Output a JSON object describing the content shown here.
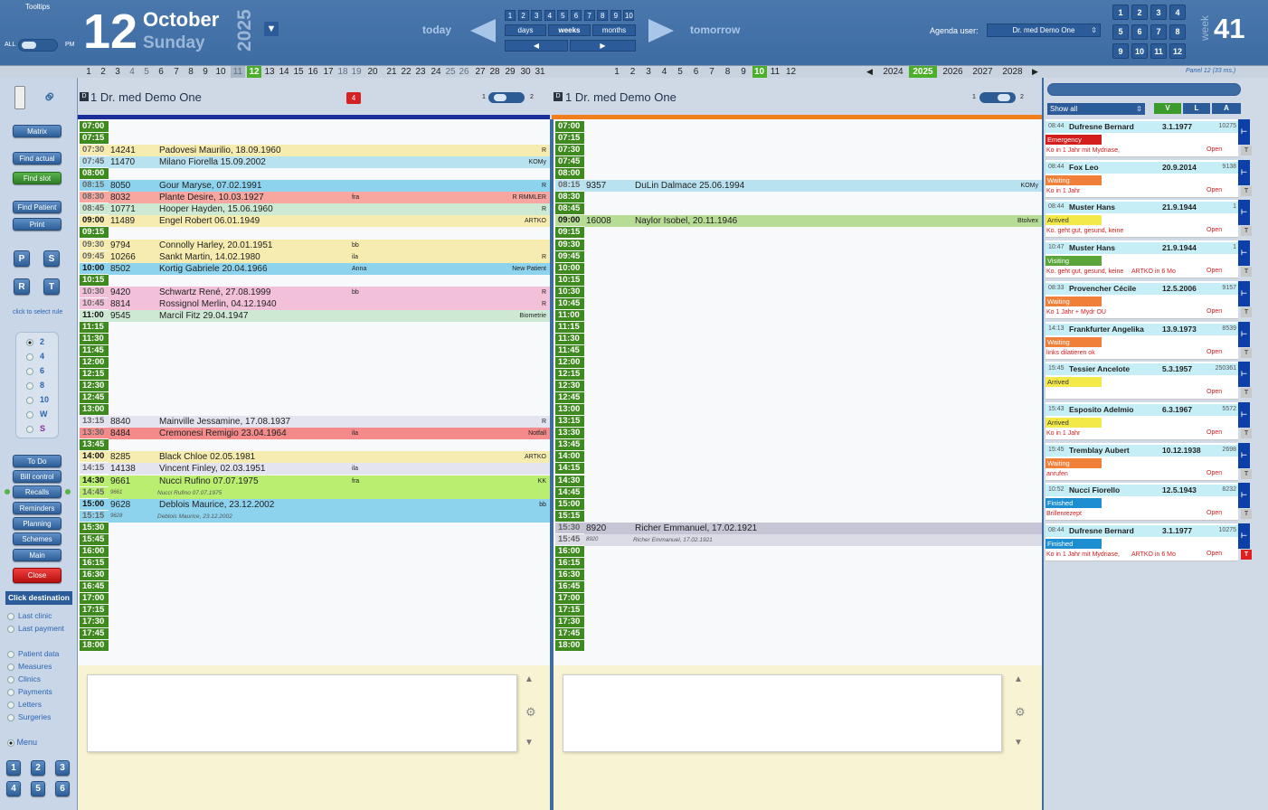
{
  "top": {
    "tooltips": "Tooltips",
    "all": "ALL",
    "pm": "PM",
    "day": "12",
    "month": "October",
    "weekday": "Sunday",
    "year": "2025",
    "today": "today",
    "tomorrow": "tomorrow",
    "nums": [
      "1",
      "2",
      "3",
      "4",
      "5",
      "6",
      "7",
      "8",
      "9",
      "10"
    ],
    "days": "days",
    "weeks": "weeks",
    "months": "months",
    "agenda_label": "Agenda user:",
    "agenda_user": "Dr. med Demo One",
    "week_label": "week",
    "week_num": "41",
    "week_grid": [
      "1",
      "2",
      "3",
      "4",
      "5",
      "6",
      "7",
      "8",
      "9",
      "10",
      "11",
      "12"
    ]
  },
  "daystrip": {
    "days": [
      "1",
      "2",
      "3",
      "4",
      "5",
      "6",
      "7",
      "8",
      "9",
      "10",
      "11",
      "12",
      "13",
      "14",
      "15",
      "16",
      "17",
      "18",
      "19",
      "20",
      "21",
      "22",
      "23",
      "24",
      "25",
      "26",
      "27",
      "28",
      "29",
      "30",
      "31"
    ],
    "months": [
      "1",
      "2",
      "3",
      "4",
      "5",
      "6",
      "7",
      "8",
      "9",
      "10",
      "11",
      "12"
    ],
    "years": [
      "2024",
      "2025",
      "2026",
      "2027",
      "2028"
    ],
    "panel": "Panel 12 (33 ms.)"
  },
  "left": {
    "matrix": "Matrix",
    "find_actual": "Find actual",
    "find_slot": "Find slot",
    "find_patient": "Find Patient",
    "print": "Print",
    "p": "P",
    "s": "S",
    "r": "R",
    "t": "T",
    "rule_hint": "click to select rule",
    "radios": [
      "2",
      "4",
      "6",
      "8",
      "10",
      "W",
      "S"
    ],
    "todo": "To Do",
    "bill": "Bill control",
    "recalls": "Recalls",
    "reminders": "Reminders",
    "planning": "Planning",
    "schemes": "Schemes",
    "main": "Main",
    "close": "Close",
    "click_dest": "Click destination",
    "dest1": [
      "Last clinic",
      "Last payment"
    ],
    "dest2": [
      "Patient data",
      "Measures",
      "Clinics",
      "Payments",
      "Letters",
      "Surgeries"
    ],
    "menu": "Menu",
    "numbtns": [
      "1",
      "2",
      "3",
      "4",
      "5",
      "6"
    ]
  },
  "col1": {
    "d": "D",
    "title": "1 Dr. med Demo One",
    "badge": "4",
    "t1": "1",
    "t2": "2"
  },
  "col2": {
    "d": "D",
    "title": "1 Dr. med Demo One",
    "t1": "1",
    "t2": "2"
  },
  "times": [
    "07:00",
    "07:15",
    "07:30",
    "07:45",
    "08:00",
    "08:15",
    "08:30",
    "08:45",
    "09:00",
    "09:15",
    "09:30",
    "09:45",
    "10:00",
    "10:15",
    "10:30",
    "10:45",
    "11:00",
    "11:15",
    "11:30",
    "11:45",
    "12:00",
    "12:15",
    "12:30",
    "12:45",
    "13:00",
    "13:15",
    "13:30",
    "13:45",
    "14:00",
    "14:15",
    "14:30",
    "14:45",
    "15:00",
    "15:15",
    "15:30",
    "15:45",
    "16:00",
    "16:15",
    "16:30",
    "16:45",
    "17:00",
    "17:15",
    "17:30",
    "17:45",
    "18:00"
  ],
  "appts1": [
    {
      "time": "07:30",
      "id": "14241",
      "name": "Padovesi Maurilio, 18.09.1960",
      "mid": "",
      "tag": "R",
      "row": 2,
      "color": "#f7ecb0"
    },
    {
      "time": "07:45",
      "id": "11470",
      "name": "Milano Fiorella 15.09.2002",
      "mid": "",
      "tag": "KOMy",
      "row": 3,
      "color": "#b8e2f0"
    },
    {
      "time": "08:15",
      "id": "8050",
      "name": "Gour Maryse, 07.02.1991",
      "mid": "",
      "tag": "R",
      "row": 5,
      "color": "#8dd3ee"
    },
    {
      "time": "08:30",
      "id": "8032",
      "name": "Plante Desire, 10.03.1927",
      "mid": "fra",
      "tag": "R RMMLER",
      "row": 6,
      "color": "#f7a6a0"
    },
    {
      "time": "08:45",
      "id": "10771",
      "name": "Hooper Hayden, 15.06.1960",
      "mid": "",
      "tag": "R",
      "row": 7,
      "color": "#cde9d4"
    },
    {
      "time": "09:00",
      "id": "11489",
      "name": "Engel Robert 06.01.1949",
      "mid": "",
      "tag": "ARTKO",
      "row": 8,
      "color": "#f7ecb0"
    },
    {
      "time": "09:30",
      "id": "9794",
      "name": "Connolly Harley, 20.01.1951",
      "mid": "bb",
      "tag": "",
      "row": 10,
      "color": "#f7ecb0"
    },
    {
      "time": "09:45",
      "id": "10266",
      "name": "Sankt Martin, 14.02.1980",
      "mid": "ila",
      "tag": "R",
      "row": 11,
      "color": "#f7ecb0"
    },
    {
      "time": "10:00",
      "id": "8502",
      "name": "Kortig Gabriele 20.04.1966",
      "mid": "Anna",
      "tag": "New Patient",
      "row": 12,
      "color": "#8dd3ee"
    },
    {
      "time": "10:30",
      "id": "9420",
      "name": "Schwartz René, 27.08.1999",
      "mid": "bb",
      "tag": "R",
      "row": 14,
      "color": "#f2c0d8"
    },
    {
      "time": "10:45",
      "id": "8814",
      "name": "Rossignol Merlin, 04.12.1940",
      "mid": "",
      "tag": "R",
      "row": 15,
      "color": "#f2c0d8"
    },
    {
      "time": "11:00",
      "id": "9545",
      "name": "Marcil Fitz 29.04.1947",
      "mid": "",
      "tag": "Biometrie",
      "row": 16,
      "color": "#cde9d4"
    },
    {
      "time": "13:15",
      "id": "8840",
      "name": "Mainville Jessamine, 17.08.1937",
      "mid": "",
      "tag": "R",
      "row": 25,
      "color": "#e4e4f0"
    },
    {
      "time": "13:30",
      "id": "8484",
      "name": "Cremonesi Remigio 23.04.1964",
      "mid": "ila",
      "tag": "Notfall",
      "row": 26,
      "color": "#f48a8a"
    },
    {
      "time": "14:00",
      "id": "8285",
      "name": "Black Chloe 02.05.1981",
      "mid": "",
      "tag": "ARTKO",
      "row": 28,
      "color": "#f7ecb0"
    },
    {
      "time": "14:15",
      "id": "14138",
      "name": "Vincent Finley, 02.03.1951",
      "mid": "ila",
      "tag": "",
      "row": 29,
      "color": "#e4e4f0"
    },
    {
      "time": "14:30",
      "id": "9661",
      "name": "Nucci Rufino 07.07.1975",
      "mid": "fra",
      "tag": "KK",
      "row": 30,
      "color": "#b9ee70"
    },
    {
      "time": "14:45",
      "id": "9661",
      "name": "Nucci Rufino 07.07.1975",
      "mid": "",
      "tag": "",
      "row": 31,
      "color": "#b9ee70",
      "small": true
    },
    {
      "time": "15:00",
      "id": "9628",
      "name": "Deblois Maurice, 23.12.2002",
      "mid": "",
      "tag": "bb",
      "row": 32,
      "color": "#8dd3ee"
    },
    {
      "time": "15:15",
      "id": "9628",
      "name": "Deblois Maurice, 23.12.2002",
      "mid": "",
      "tag": "",
      "row": 33,
      "color": "#8dd3ee",
      "small": true
    }
  ],
  "appts2": [
    {
      "time": "08:15",
      "id": "9357",
      "name": "DuLin Dalmace 25.06.1994",
      "mid": "",
      "tag": "KOMy",
      "row": 5,
      "color": "#b8e2f0"
    },
    {
      "time": "09:00",
      "id": "16008",
      "name": "Naylor Isobel, 20.11.1946",
      "mid": "",
      "tag": "Btolvex",
      "row": 8,
      "color": "#b7dc95"
    },
    {
      "time": "15:30",
      "id": "8920",
      "name": "Richer Emmanuel, 17.02.1921",
      "mid": "",
      "tag": "",
      "row": 34,
      "color": "#c5c5d6"
    },
    {
      "time": "15:45",
      "id": "8920",
      "name": "Richer Emmanuel, 17.02.1921",
      "mid": "",
      "tag": "",
      "row": 35,
      "color": "#dcdce6",
      "small": true
    }
  ],
  "right": {
    "filter": "Show all",
    "v": "V",
    "l": "L",
    "a": "A"
  },
  "cards": [
    {
      "time": "08:44",
      "name": "Dufresne Bernard",
      "dob": "3.1.1977",
      "num": "10275",
      "status": "Emergency",
      "scolor": "#d41d1d",
      "note": "Ko in 1 Jahr mit Mydriase,",
      "note2": "",
      "open": "Open",
      "t": "T",
      "tred": false
    },
    {
      "time": "08:44",
      "name": "Fox Leo",
      "dob": "20.9.2014",
      "num": "9138",
      "status": "Waiting",
      "scolor": "#f07f3a",
      "note": "Ko in 1 Jahr",
      "note2": "",
      "open": "Open",
      "t": "T",
      "tred": false
    },
    {
      "time": "08:44",
      "name": "Muster Hans",
      "dob": "21.9.1944",
      "num": "1",
      "status": "Arrived",
      "scolor": "#f3ea4a",
      "note": "Ko. geht gut, gesund, keine",
      "note2": "",
      "open": "Open",
      "t": "T",
      "tred": false
    },
    {
      "time": "10:47",
      "name": "Muster Hans",
      "dob": "21.9.1944",
      "num": "1",
      "status": "Visiting",
      "scolor": "#5aa63a",
      "note": "Ko. geht gut, gesund, keine",
      "note2": "ARTKO in 6 Mo",
      "open": "Open",
      "t": "T",
      "tred": false
    },
    {
      "time": "08:33",
      "name": "Provencher Cécile",
      "dob": "12.5.2006",
      "num": "9157",
      "status": "Waiting",
      "scolor": "#f07f3a",
      "note": "Ko 1 Jahr + Mydr OU",
      "note2": "",
      "open": "Open",
      "t": "T",
      "tred": false
    },
    {
      "time": "14:13",
      "name": "Frankfurter Angelika",
      "dob": "13.9.1973",
      "num": "8539",
      "status": "Waiting",
      "scolor": "#f07f3a",
      "note": "links dilatieren ok",
      "note2": "",
      "open": "Open",
      "t": "T",
      "tred": false
    },
    {
      "time": "15:45",
      "name": "Tessier Ancelote",
      "dob": "5.3.1957",
      "num": "250361",
      "status": "Arrived",
      "scolor": "#f3ea4a",
      "note": "",
      "note2": "",
      "open": "Open",
      "t": "T",
      "tred": false
    },
    {
      "time": "15:43",
      "name": "Esposito Adelmio",
      "dob": "6.3.1967",
      "num": "5572",
      "status": "Arrived",
      "scolor": "#f3ea4a",
      "note": "Ko in 1 Jahr",
      "note2": "",
      "open": "Open",
      "t": "T",
      "tred": false
    },
    {
      "time": "15:45",
      "name": "Tremblay Aubert",
      "dob": "10.12.1938",
      "num": "2698",
      "status": "Waiting",
      "scolor": "#f07f3a",
      "note": "anrufen",
      "note2": "",
      "open": "Open",
      "t": "T",
      "tred": false
    },
    {
      "time": "10:52",
      "name": "Nucci Fiorello",
      "dob": "12.5.1943",
      "num": "8232",
      "status": "Finished",
      "scolor": "#1d8fd0",
      "note": "Brillenrezept",
      "note2": "",
      "open": "Open",
      "t": "T",
      "tred": false
    },
    {
      "time": "08:44",
      "name": "Dufresne Bernard",
      "dob": "3.1.1977",
      "num": "10275",
      "status": "Finished",
      "scolor": "#1d8fd0",
      "note": "Ko in 1 Jahr mit Mydriase,",
      "note2": "ARTKO in 6 Mo",
      "open": "Open",
      "t": "T",
      "tred": true
    }
  ]
}
